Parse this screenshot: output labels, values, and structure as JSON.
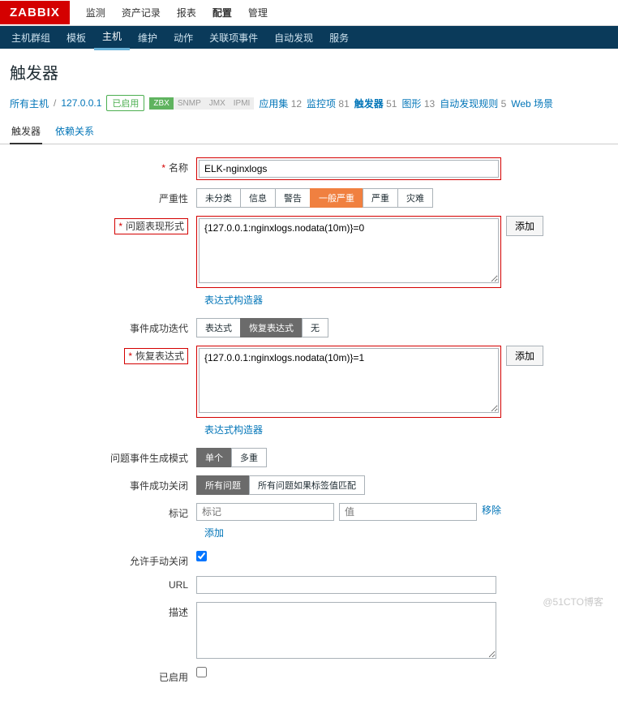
{
  "logo": "ZABBIX",
  "topnav": {
    "items": [
      "监测",
      "资产记录",
      "报表",
      "配置",
      "管理"
    ],
    "active": 3
  },
  "subnav": {
    "items": [
      "主机群组",
      "模板",
      "主机",
      "维护",
      "动作",
      "关联项事件",
      "自动发现",
      "服务"
    ],
    "active": 2
  },
  "page_title": "触发器",
  "crumbs": {
    "all_hosts": "所有主机",
    "host": "127.0.0.1",
    "status": "已启用",
    "ifaces": [
      "ZBX",
      "SNMP",
      "JMX",
      "IPMI"
    ],
    "links": [
      {
        "label": "应用集",
        "count": "12"
      },
      {
        "label": "监控项",
        "count": "81"
      },
      {
        "label": "触发器",
        "count": "51",
        "active": true
      },
      {
        "label": "图形",
        "count": "13"
      },
      {
        "label": "自动发现规则",
        "count": "5"
      },
      {
        "label": "Web 场景",
        "count": ""
      }
    ]
  },
  "tabs": {
    "active": "触发器",
    "other": "依赖关系"
  },
  "form": {
    "name_label": "名称",
    "name_value": "ELK-nginxlogs",
    "severity_label": "严重性",
    "severity_opts": [
      "未分类",
      "信息",
      "警告",
      "一般严重",
      "严重",
      "灾难"
    ],
    "problem_expr_label": "问题表现形式",
    "problem_expr_value": "{127.0.0.1:nginxlogs.nodata(10m)}=0",
    "add_btn": "添加",
    "expr_builder": "表达式构造器",
    "ok_iter_label": "事件成功迭代",
    "ok_iter_opts": [
      "表达式",
      "恢复表达式",
      "无"
    ],
    "recovery_expr_label": "恢复表达式",
    "recovery_expr_value": "{127.0.0.1:nginxlogs.nodata(10m)}=1",
    "prob_gen_label": "问题事件生成模式",
    "prob_gen_opts": [
      "单个",
      "多重"
    ],
    "ok_close_label": "事件成功关闭",
    "ok_close_opts": [
      "所有问题",
      "所有问题如果标签值匹配"
    ],
    "tags_label": "标记",
    "tag_ph": "标记",
    "val_ph": "值",
    "remove": "移除",
    "add_link": "添加",
    "manual_close_label": "允许手动关闭",
    "url_label": "URL",
    "desc_label": "描述",
    "enabled_label": "已启用"
  },
  "watermark": "@51CTO博客"
}
